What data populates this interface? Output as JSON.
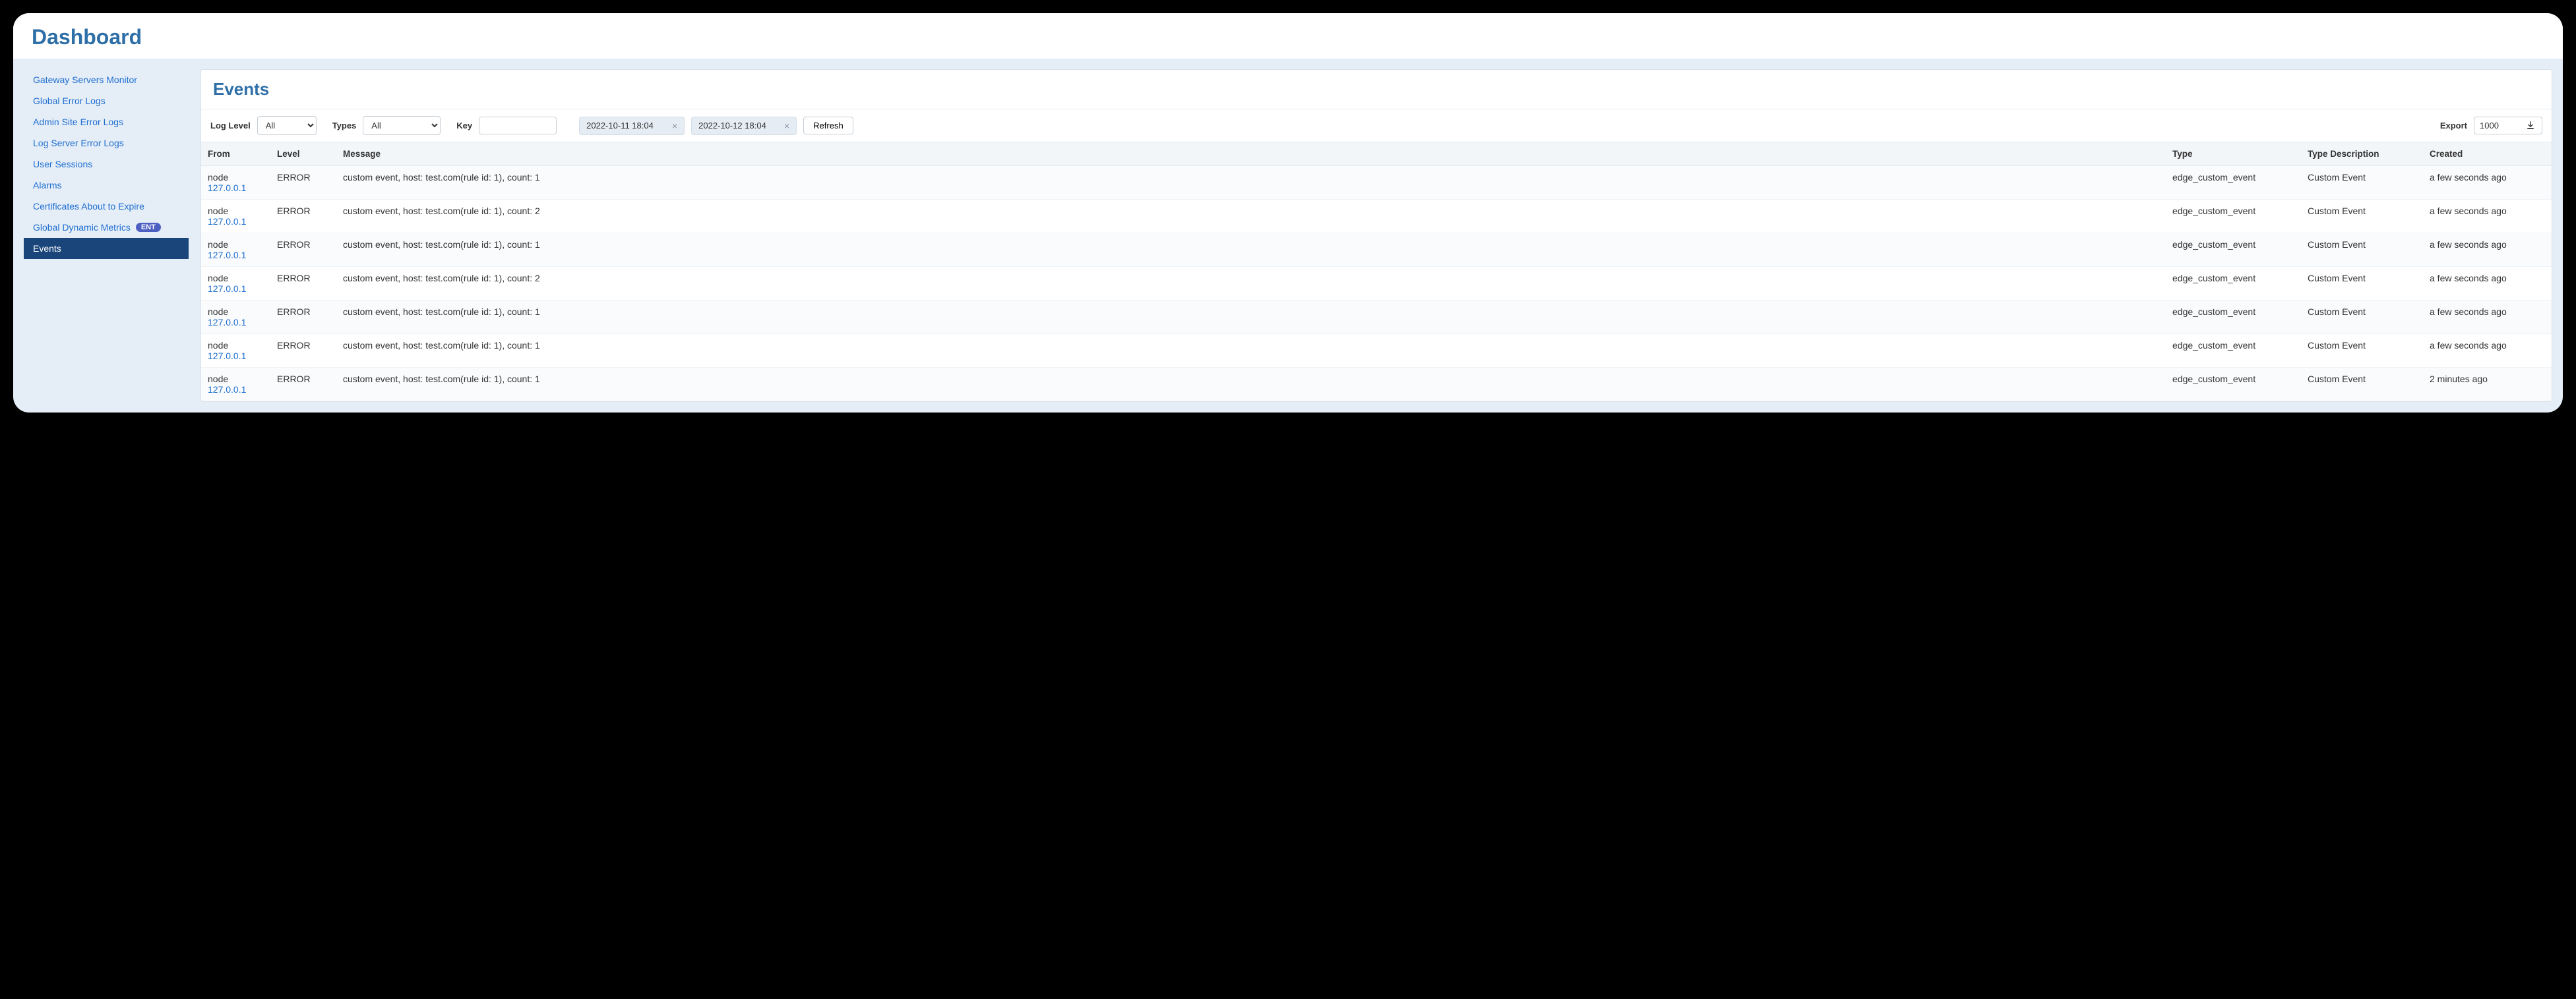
{
  "header": {
    "title": "Dashboard"
  },
  "sidebar": {
    "items": [
      {
        "label": "Gateway Servers Monitor",
        "active": false,
        "badge": ""
      },
      {
        "label": "Global Error Logs",
        "active": false,
        "badge": ""
      },
      {
        "label": "Admin Site Error Logs",
        "active": false,
        "badge": ""
      },
      {
        "label": "Log Server Error Logs",
        "active": false,
        "badge": ""
      },
      {
        "label": "User Sessions",
        "active": false,
        "badge": ""
      },
      {
        "label": "Alarms",
        "active": false,
        "badge": ""
      },
      {
        "label": "Certificates About to Expire",
        "active": false,
        "badge": ""
      },
      {
        "label": "Global Dynamic Metrics",
        "active": false,
        "badge": "ENT"
      },
      {
        "label": "Events",
        "active": true,
        "badge": ""
      }
    ]
  },
  "page": {
    "title": "Events"
  },
  "filters": {
    "log_level_label": "Log Level",
    "log_level_value": "All",
    "types_label": "Types",
    "types_value": "All",
    "key_label": "Key",
    "key_value": "",
    "date_from": "2022-10-11 18:04",
    "date_to": "2022-10-12 18:04",
    "refresh_label": "Refresh",
    "export_label": "Export",
    "export_value": "1000"
  },
  "table": {
    "headers": {
      "from": "From",
      "level": "Level",
      "message": "Message",
      "type": "Type",
      "type_desc": "Type Description",
      "created": "Created"
    },
    "rows": [
      {
        "from_label": "node",
        "from_ip": "127.0.0.1",
        "level": "ERROR",
        "message": "custom event, host: test.com(rule id: 1), count: 1",
        "type": "edge_custom_event",
        "type_desc": "Custom Event",
        "created": "a few seconds ago"
      },
      {
        "from_label": "node",
        "from_ip": "127.0.0.1",
        "level": "ERROR",
        "message": "custom event, host: test.com(rule id: 1), count: 2",
        "type": "edge_custom_event",
        "type_desc": "Custom Event",
        "created": "a few seconds ago"
      },
      {
        "from_label": "node",
        "from_ip": "127.0.0.1",
        "level": "ERROR",
        "message": "custom event, host: test.com(rule id: 1), count: 1",
        "type": "edge_custom_event",
        "type_desc": "Custom Event",
        "created": "a few seconds ago"
      },
      {
        "from_label": "node",
        "from_ip": "127.0.0.1",
        "level": "ERROR",
        "message": "custom event, host: test.com(rule id: 1), count: 2",
        "type": "edge_custom_event",
        "type_desc": "Custom Event",
        "created": "a few seconds ago"
      },
      {
        "from_label": "node",
        "from_ip": "127.0.0.1",
        "level": "ERROR",
        "message": "custom event, host: test.com(rule id: 1), count: 1",
        "type": "edge_custom_event",
        "type_desc": "Custom Event",
        "created": "a few seconds ago"
      },
      {
        "from_label": "node",
        "from_ip": "127.0.0.1",
        "level": "ERROR",
        "message": "custom event, host: test.com(rule id: 1), count: 1",
        "type": "edge_custom_event",
        "type_desc": "Custom Event",
        "created": "a few seconds ago"
      },
      {
        "from_label": "node",
        "from_ip": "127.0.0.1",
        "level": "ERROR",
        "message": "custom event, host: test.com(rule id: 1), count: 1",
        "type": "edge_custom_event",
        "type_desc": "Custom Event",
        "created": "2 minutes ago"
      }
    ]
  }
}
